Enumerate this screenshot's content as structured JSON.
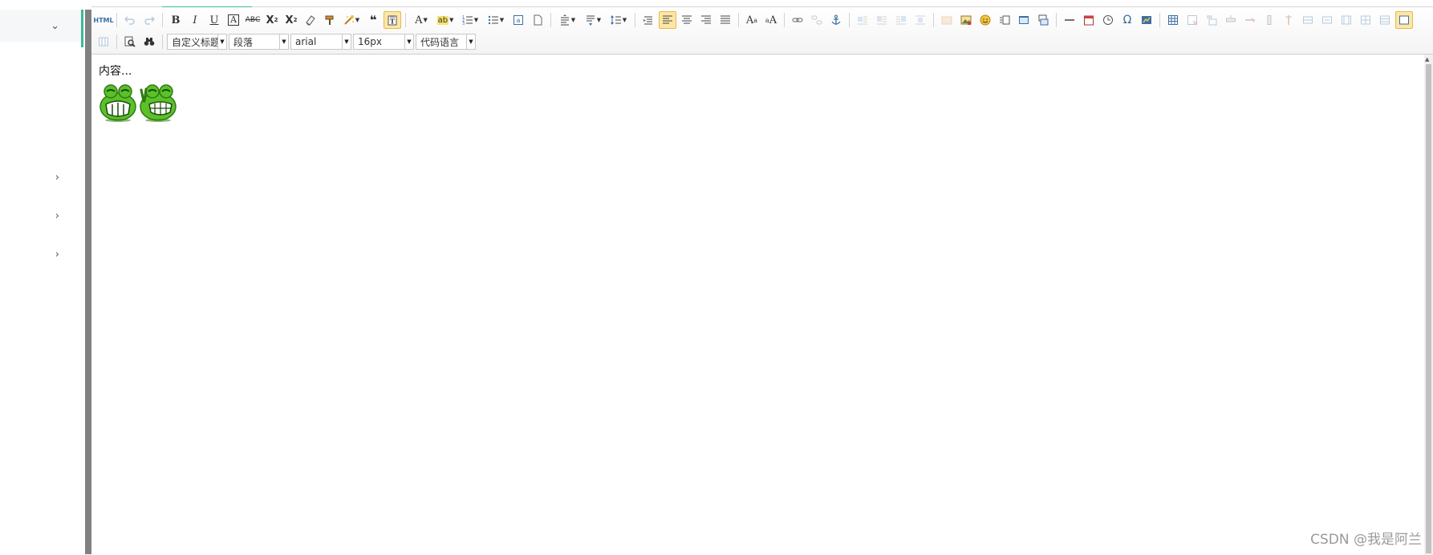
{
  "sidebar": {
    "items": [
      {
        "chevron": "⌄"
      },
      {
        "chevron": "›"
      },
      {
        "chevron": "›"
      },
      {
        "chevron": "›"
      }
    ]
  },
  "toolbar": {
    "html_label": "HTML",
    "select_customstyle": "自定义标题",
    "select_paragraph": "段落",
    "select_fontfamily": "arial",
    "select_fontsize": "16px",
    "select_codelanguage": "代码语言",
    "icons_row1": [
      "html-source-icon",
      "undo-icon",
      "redo-icon",
      "bold-icon",
      "italic-icon",
      "underline-icon",
      "font-border-icon",
      "strikethrough-icon",
      "superscript-icon",
      "subscript-icon",
      "eraser-icon",
      "format-painter-icon",
      "auto-typeset-icon",
      "blockquote-icon",
      "paste-plain-icon",
      "font-color-icon",
      "background-color-icon",
      "ordered-list-icon",
      "unordered-list-icon",
      "select-all-icon",
      "clear-doc-icon",
      "row-spacing-top-icon",
      "row-spacing-bottom-icon",
      "line-height-icon",
      "direction-ltr-icon",
      "align-left-icon",
      "align-center-icon",
      "align-right-icon",
      "justify-icon",
      "touppercase-icon",
      "tolowercase-icon",
      "link-icon",
      "unlink-icon",
      "anchor-icon",
      "image-none-icon",
      "image-left-icon",
      "image-right-icon",
      "image-center-icon",
      "simple-upload-icon",
      "insert-image-icon",
      "emoticon-icon",
      "insert-frame-icon",
      "insert-code-icon",
      "page-break-icon",
      "horizontal-rule-icon",
      "date-icon",
      "time-icon",
      "special-chars-icon",
      "wordimage-icon",
      "insert-table-icon",
      "delete-table-icon",
      "insert-paragraph-before-table-icon",
      "insert-row-icon",
      "delete-row-icon",
      "insert-col-icon",
      "delete-col-icon",
      "merge-cells-icon",
      "merge-right-icon",
      "merge-down-icon",
      "split-to-cells-icon",
      "split-to-rows-icon"
    ],
    "icons_row2": [
      "split-to-cols-icon",
      "print-preview-icon",
      "search-replace-icon"
    ]
  },
  "content": {
    "text": "内容...",
    "images": [
      "frog-emoticon-grin",
      "frog-emoticon-victory"
    ]
  },
  "watermark": "CSDN @我是阿兰",
  "colors": {
    "accent": "#3bb99a",
    "active_button_bg": "#fde7a6",
    "active_button_border": "#e7b94c",
    "frog_green": "#5bc12a"
  }
}
